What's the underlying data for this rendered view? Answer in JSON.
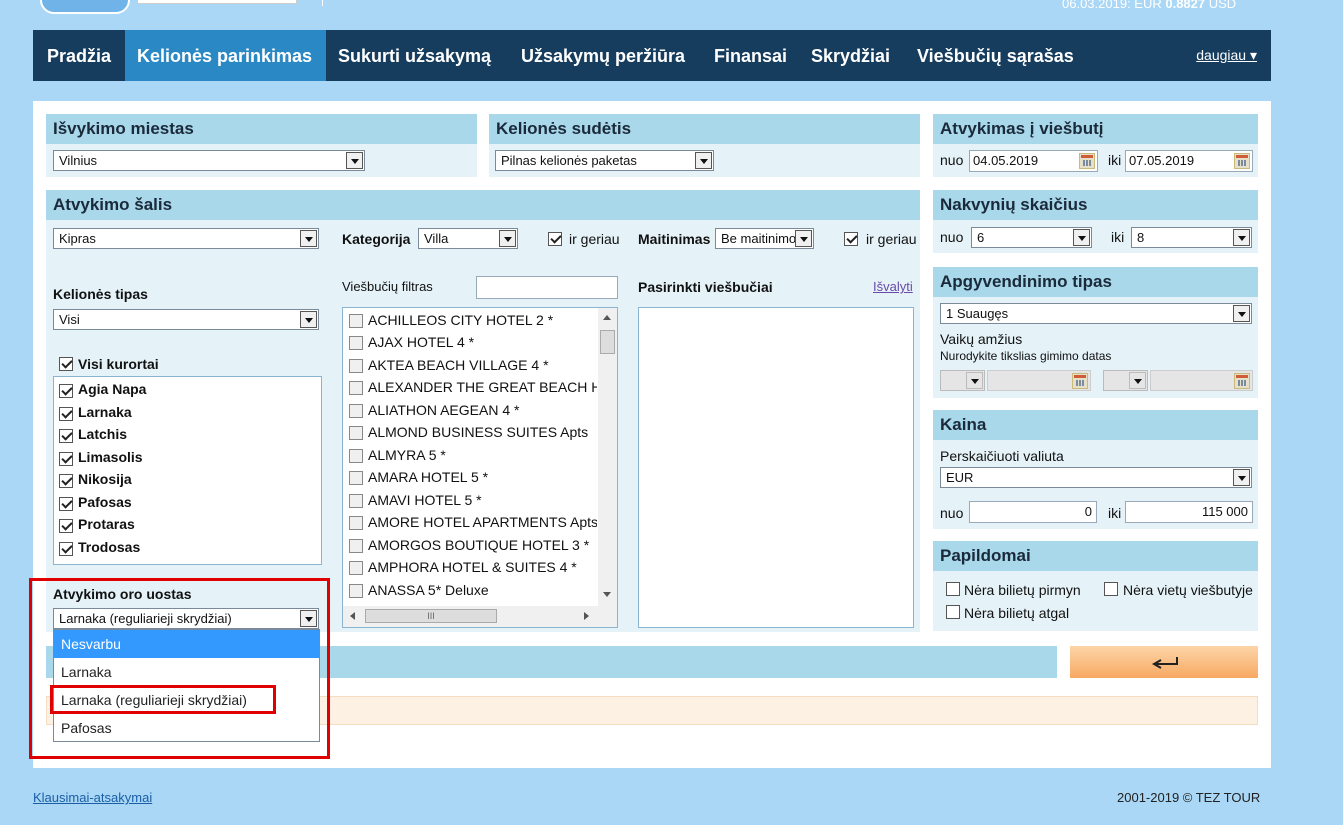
{
  "header": {
    "rate_text": "06.03.2019:  EUR",
    "rate_value": "0.8827",
    "rate_currency": "USD"
  },
  "nav": {
    "items": [
      "Pradžia",
      "Kelionės parinkimas",
      "Sukurti užsakymą",
      "Užsakymų peržiūra",
      "Finansai",
      "Skrydžiai",
      "Viešbučių sąrašas"
    ],
    "active_index": 1,
    "more_label": "daugiau ▾"
  },
  "departure": {
    "title": "Išvykimo miestas",
    "value": "Vilnius"
  },
  "composition": {
    "title": "Kelionės sudėtis",
    "value": "Pilnas kelionės paketas"
  },
  "checkin": {
    "title": "Atvykimas į viešbutį",
    "from_label": "nuo",
    "from": "04.05.2019",
    "to_label": "iki",
    "to": "07.05.2019"
  },
  "nights": {
    "title": "Nakvynių skaičius",
    "from_label": "nuo",
    "from": "6",
    "to_label": "iki",
    "to": "8"
  },
  "country": {
    "title": "Atvykimo šalis",
    "value": "Kipras",
    "category_label": "Kategorija",
    "category_value": "Villa",
    "category_better": "ir geriau",
    "meal_label": "Maitinimas",
    "meal_value": "Be maitinimo",
    "meal_better": "ir geriau"
  },
  "trip_type": {
    "label": "Kelionės tipas",
    "value": "Visi"
  },
  "resorts": {
    "all_label": "Visi kurortai",
    "items": [
      "Agia Napa",
      "Larnaka",
      "Latchis",
      "Limasolis",
      "Nikosija",
      "Pafosas",
      "Protaras",
      "Trodosas"
    ]
  },
  "hotel_filter": {
    "label": "Viešbučių filtras",
    "value": "",
    "hotels": [
      "ACHILLEOS CITY HOTEL 2 *",
      "AJAX HOTEL 4 *",
      "AKTEA BEACH VILLAGE 4 *",
      "ALEXANDER THE GREAT BEACH HOTEL",
      "ALIATHON AEGEAN 4 *",
      "ALMOND BUSINESS SUITES Apts",
      "ALMYRA 5 *",
      "AMARA HOTEL 5 *",
      "AMAVI HOTEL 5 *",
      "AMORE HOTEL APARTMENTS Apts",
      "AMORGOS BOUTIQUE HOTEL 3 *",
      "AMPHORA HOTEL & SUITES 4 *",
      "ANASSA 5* Deluxe"
    ],
    "scroll_mark": "III"
  },
  "selected_hotels": {
    "label": "Pasirinkti viešbučiai",
    "clear_label": "Išvalyti"
  },
  "airport": {
    "label": "Atvykimo oro uostas",
    "value": "Larnaka (reguliarieji skrydžiai)",
    "options": [
      "Nesvarbu",
      "Larnaka",
      "Larnaka (reguliarieji skrydžiai)",
      "Pafosas"
    ],
    "highlighted_index": 0
  },
  "accommodation": {
    "title": "Apgyvendinimo tipas",
    "value": "1 Suaugęs",
    "children_label": "Vaikų amžius",
    "children_hint": "Nurodykite tikslias gimimo datas"
  },
  "price": {
    "title": "Kaina",
    "currency_label": "Perskaičiuoti valiuta",
    "currency": "EUR",
    "from_label": "nuo",
    "from": "0",
    "to_label": "iki",
    "to": "115 000"
  },
  "extra": {
    "title": "Papildomai",
    "no_tickets_there": "Nėra bilietų pirmyn",
    "no_hotel_places": "Nėra vietų viešbutyje",
    "no_tickets_back": "Nėra bilietų atgal"
  },
  "search_button": {
    "icon": "enter-arrow-icon"
  },
  "footer": {
    "faq": "Klausimai-atsakymai",
    "copyright": "2001-2019 © TEZ TOUR"
  },
  "colors": {
    "nav_bg": "#163d5e",
    "nav_active": "#2a88c5",
    "panel_header": "#a9d8ea",
    "panel_body": "#e5f3f9",
    "highlight": "#e00000",
    "option_selected": "#3399ff"
  }
}
